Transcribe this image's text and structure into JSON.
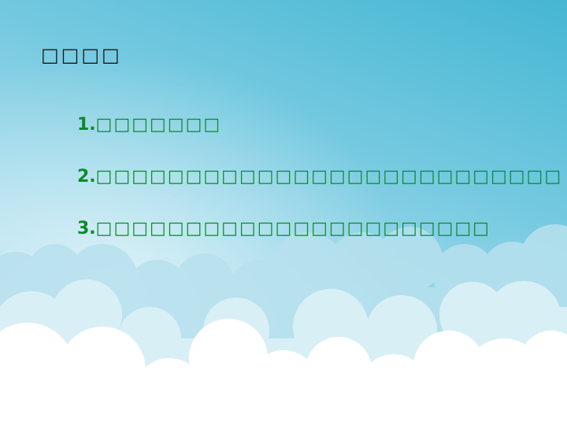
{
  "slide": {
    "title": "□□□□",
    "items": [
      {
        "number": "1.",
        "text": "□□□□□□□"
      },
      {
        "number": "2.",
        "text": "□□□□□□□□□□□□□□□□□□□□□□□□□□"
      },
      {
        "number": "3.",
        "text": "□□□□□□□□□□□□□□□□□□□□□□"
      }
    ]
  },
  "colors": {
    "title": "#1a1a1a",
    "items": "#0a8a2a",
    "sky_top": "#45b6d3",
    "sky_bottom": "#c9e9f3",
    "cloud_back": "#b9e2ee",
    "cloud_front": "#ffffff"
  },
  "icons": [
    "cloud-bank"
  ]
}
